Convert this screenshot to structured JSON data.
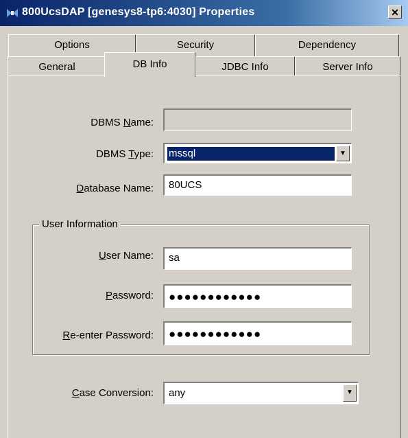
{
  "window": {
    "title": "800UcsDAP [genesys8-tp6:4030] Properties",
    "close_glyph": "✕"
  },
  "tabs": {
    "back_row": [
      "Options",
      "Security",
      "Dependency"
    ],
    "front_row": [
      "General",
      "DB Info",
      "JDBC Info",
      "Server Info"
    ],
    "active": "DB Info"
  },
  "form": {
    "dbms_name": {
      "label_pre": "DBMS ",
      "label_u": "N",
      "label_post": "ame:",
      "value": ""
    },
    "dbms_type": {
      "label_pre": "DBMS ",
      "label_u": "T",
      "label_post": "ype:",
      "value": "mssql"
    },
    "database_name": {
      "label_pre": "",
      "label_u": "D",
      "label_post": "atabase Name:",
      "value": "80UCS"
    },
    "user_group": {
      "title": "User Information",
      "user_name": {
        "label_pre": "",
        "label_u": "U",
        "label_post": "ser Name:",
        "value": "sa"
      },
      "password": {
        "label_pre": "",
        "label_u": "P",
        "label_post": "assword:",
        "value": "●●●●●●●●●●●●"
      },
      "reenter_password": {
        "label_pre": "",
        "label_u": "R",
        "label_post": "e-enter Password:",
        "value": "●●●●●●●●●●●●"
      }
    },
    "case_conversion": {
      "label_pre": "",
      "label_u": "C",
      "label_post": "ase Conversion:",
      "value": "any"
    }
  },
  "icons": {
    "window_icon": "network-dap-icon",
    "dropdown": "chevron-down-icon"
  }
}
